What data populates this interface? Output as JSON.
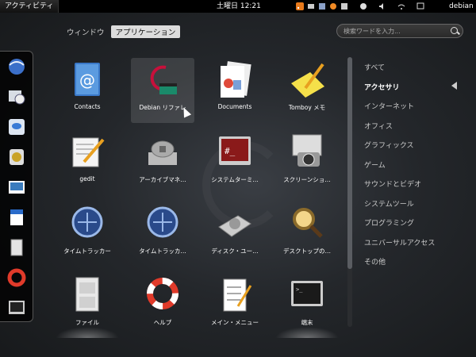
{
  "topbar": {
    "activities": "アクティビティ",
    "clock": "土曜日 12:21",
    "username": "debian",
    "tray_icons": [
      "rss-icon",
      "mail-icon",
      "keyboard-layout-icon",
      "settings-icon",
      "chat-icon",
      "accessibility-icon",
      "volume-icon",
      "network-icon",
      "user-icon"
    ]
  },
  "view_tabs": [
    "ウィンドウ",
    "アプリケーション"
  ],
  "search": {
    "placeholder": "検索ワードを入力..."
  },
  "dash": [
    "web-browser-icon",
    "mail-clock-icon",
    "chat-bubble-icon",
    "sound-juicer-icon",
    "image-viewer-icon",
    "document-writer-icon",
    "file-cabinet-icon",
    "lifebuoy-icon",
    "terminal-icon"
  ],
  "apps": [
    {
      "label": "Contacts",
      "icon": "contacts-icon"
    },
    {
      "label": "Debian リファレ",
      "icon": "debian-reference-icon"
    },
    {
      "label": "Documents",
      "icon": "documents-icon"
    },
    {
      "label": "Tomboy メモ",
      "icon": "tomboy-notes-icon"
    },
    {
      "label": "gedit",
      "icon": "text-editor-icon"
    },
    {
      "label": "アーカイブマネ…",
      "icon": "archive-manager-icon"
    },
    {
      "label": "システムターミ…",
      "icon": "system-terminal-icon"
    },
    {
      "label": "スクリーンショ…",
      "icon": "screenshot-icon"
    },
    {
      "label": "タイムトラッカー",
      "icon": "time-tracker-icon"
    },
    {
      "label": "タイムトラッカ…",
      "icon": "time-tracker-icon"
    },
    {
      "label": "ディスク・ユー…",
      "icon": "disk-usage-icon"
    },
    {
      "label": "デスクトップの…",
      "icon": "desktop-search-icon"
    },
    {
      "label": "ファイル",
      "icon": "files-icon"
    },
    {
      "label": "ヘルプ",
      "icon": "help-icon"
    },
    {
      "label": "メイン・メニュー",
      "icon": "main-menu-icon"
    },
    {
      "label": "端末",
      "icon": "terminal-icon"
    }
  ],
  "categories": [
    "すべて",
    "アクセサリ",
    "インターネット",
    "オフィス",
    "グラフィックス",
    "ゲーム",
    "サウンドとビデオ",
    "システムツール",
    "プログラミング",
    "ユニバーサルアクセス",
    "その他"
  ],
  "active_category": "アクセサリ"
}
